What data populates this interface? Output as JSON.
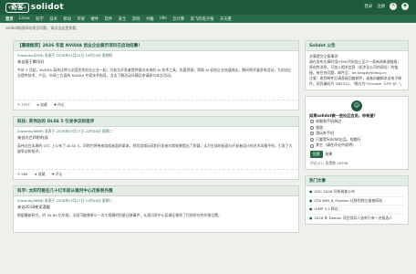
{
  "header": {
    "logo_mark": "‹奇客›",
    "logo_name": "solidot",
    "user": [
      "登录",
      "注册"
    ],
    "icons": [
      "text-size-icon",
      "rss-icon"
    ]
  },
  "nav": {
    "items": [
      "首页",
      "Linux",
      "科学",
      "技术",
      "移动",
      "苹果",
      "硬件",
      "软件",
      "安全",
      "游戏",
      "书籍",
      "idle",
      "云计算",
      "高飞的电子报",
      "天天看"
    ],
    "active_index": 0
  },
  "breadcrumb": "solidot新版网站常见问题，请点击这里查看。",
  "posts": [
    {
      "title": "【重磅推荐】2026 年度 NVIDIA 创业企业展示项目已启动招募！",
      "meta": "Edwards(8266) 发表于 2026年01月22日 10时29分 星期四",
      "sub": "来自基于腾讯对",
      "body": "今年 3 月起，NVIDIA 英伟达将与全国优秀创业企业一起，为各位开发者提供面向未来的 AI 技术工具、优惠资源，帮助 AI 初创企业加速成长。期间将开展多场活动，为初创企业提供技术、产品、市场三方面的 NVIDIA 专家技术指导。点击了解活动详情及申请参与本次活动。",
      "comments": "3707",
      "stat2": "收藏",
      "stat3": "评论"
    },
    {
      "title": "科技: 英伟达的 DLSS 5 引发争议和批评",
      "meta": "Edwards(6866) 发表于 2026年03月17日 22时46分 星期二",
      "sub": "来自光芒四射的部",
      "body": "英伟达在本周的 GTC 上公布了 DLSS 5，声称它将带来游戏画面的革命。然而游戏玩家和开发者对其效果提出了质疑，认为生成的画面与开发者设计的艺术风格不符，引发了大量争议和批评。",
      "comments": "986",
      "stat2": "收藏",
      "stat3": "评论"
    },
    {
      "title": "科学: 太阳可能在几十亿年前从银河中心迁移到外围",
      "meta": "Edwards(6868) 发表于 2026年03月17日 21时48分 星期二",
      "sub": "来自2018夜读温暖",
      "body": "根据最新研究，约 40-60 亿年前，太阳可能曾参与一次大规模的恒星迁移事件，从银河系中心区域迁移到了目前所在的外围位置。",
      "comments": "",
      "stat2": "",
      "stat3": ""
    }
  ],
  "sidebar": {
    "notice": {
      "title": "Solidot 公告",
      "lines": [
        "文章提交注意事项：",
        "请在发布文章时用HTML代码加上至少一条新闻来源链接；原创性消息，可加入相关信息（如涉及公司的网址）的链接。有任何问题，邮件至：he.fang#zhiding.cn",
        "注意：收到邮件后请直接回复邮件，或者向编辑发送电子邮件。网页编码为 GB2312，\"格式为\"Unicode（UTF-8）\"。"
      ]
    },
    "poll": {
      "question": "如果solidot做一些社区会员，你希望？",
      "options": [
        "电脑和手机周边",
        "旅游",
        "游玩补手机",
        "只要是Solidot出品，啥都行",
        "其它（请在评论中说明）"
      ],
      "vote_label": "投票",
      "results_label": "结果",
      "footer": "评论(4) | 投票数 26396"
    },
    "hot": {
      "title": "热门文章",
      "items": [
        "GDC 2026 问卷调查公布",
        "GTA WiN 从 Fandom 迁移到独立维基网站",
        "GIMP 3.2 释出",
        "2026 年 Debian 项目领导人选举只有一名候选人"
      ]
    }
  }
}
